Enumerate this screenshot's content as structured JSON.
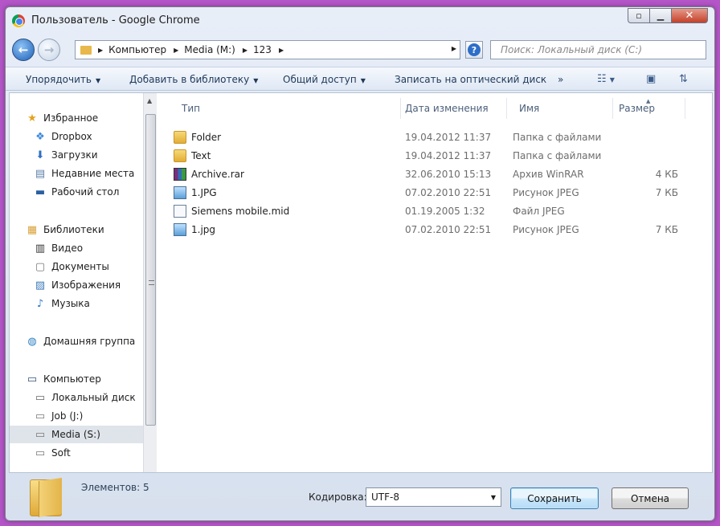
{
  "window": {
    "title": "Пользователь - Google Chrome"
  },
  "titlebar_buttons": [
    "restore",
    "minimize",
    "close"
  ],
  "nav": {
    "breadcrumbs": [
      "Компьютер",
      "Media (M:)",
      "123"
    ],
    "search_placeholder": "Поиск: Локальный диск (C:)"
  },
  "toolbar": {
    "organize": "Упорядочить",
    "add_to_library": "Добавить в библиотеку",
    "share": "Общий доступ",
    "burn": "Записать на оптический диск",
    "more": "»"
  },
  "sidebar": {
    "favorites": {
      "label": "Избранное",
      "items": [
        "Dropbox",
        "Загрузки",
        "Недавние места",
        "Рабочий стол"
      ]
    },
    "libraries": {
      "label": "Библиотеки",
      "items": [
        "Видео",
        "Документы",
        "Изображения",
        "Музыка"
      ]
    },
    "homegroup": {
      "label": "Домашняя группа"
    },
    "computer": {
      "label": "Компьютер",
      "items": [
        "Локальный диск",
        "Job (J:)",
        "Media (S:)",
        "Soft"
      ]
    },
    "selected": "Media (S:)"
  },
  "columns": {
    "type": "Тип",
    "date": "Дата изменения",
    "name": "Имя",
    "size": "Размер"
  },
  "files": [
    {
      "name": "Folder",
      "date": "19.04.2012 11:37",
      "type": "Папка с файлами",
      "size": "",
      "icon": "folder-icon"
    },
    {
      "name": "Text",
      "date": "19.04.2012 11:37",
      "type": "Папка с файлами",
      "size": "",
      "icon": "folder-icon"
    },
    {
      "name": "Archive.rar",
      "date": "32.06.2010 15:13",
      "type": "Архив WinRAR",
      "size": "4 КБ",
      "icon": "winrar-icon"
    },
    {
      "name": "1.JPG",
      "date": "07.02.2010 22:51",
      "type": "Рисунок JPEG",
      "size": "7 КБ",
      "icon": "image-icon"
    },
    {
      "name": "Siemens mobile.mid",
      "date": "01.19.2005 1:32",
      "type": "Файл JPEG",
      "size": "",
      "icon": "midi-file-icon"
    },
    {
      "name": "1.jpg",
      "date": "07.02.2010 22:51",
      "type": "Рисунок JPEG",
      "size": "7 КБ",
      "icon": "image-icon"
    }
  ],
  "footer": {
    "items_count": "Элементов: 5",
    "encoding_label": "Кодировка:",
    "encoding_value": "UTF-8",
    "save": "Сохранить",
    "cancel": "Отмена"
  }
}
